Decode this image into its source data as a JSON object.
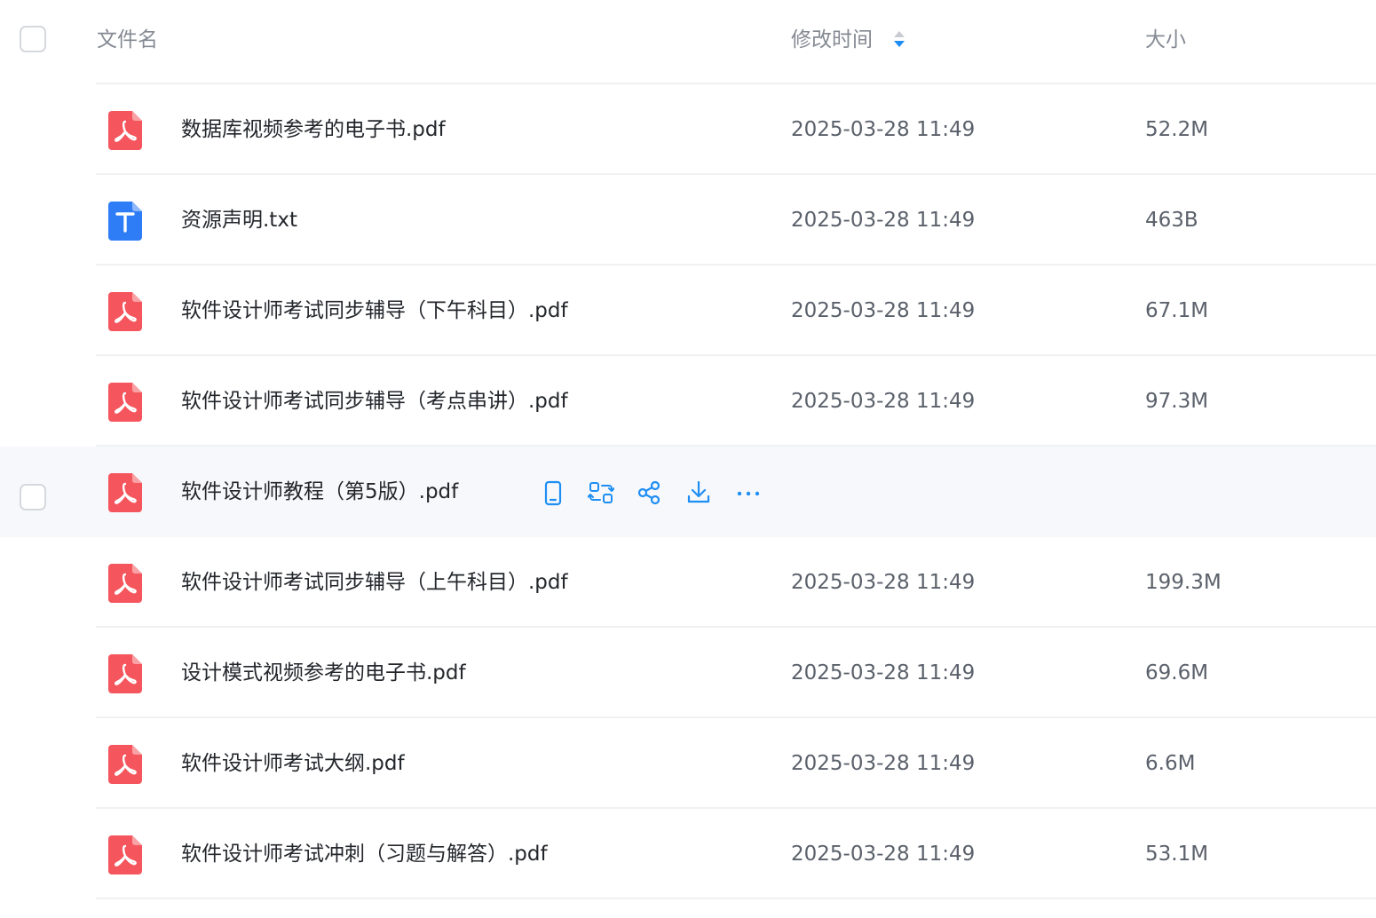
{
  "header": {
    "name_label": "文件名",
    "time_label": "修改时间",
    "size_label": "大小",
    "sort_icon": "sort-updown-icon",
    "sort_active_color": "#1e8ef5"
  },
  "colors": {
    "accent": "#1e8ef5",
    "pdf": "#f5555c",
    "txt": "#2f7df6"
  },
  "files": [
    {
      "name": "数据库视频参考的电子书.pdf",
      "type": "pdf",
      "modified": "2025-03-28 11:49",
      "size": "52.2M"
    },
    {
      "name": "资源声明.txt",
      "type": "txt",
      "modified": "2025-03-28 11:49",
      "size": "463B"
    },
    {
      "name": "软件设计师考试同步辅导（下午科目）.pdf",
      "type": "pdf",
      "modified": "2025-03-28 11:49",
      "size": "67.1M"
    },
    {
      "name": "软件设计师考试同步辅导（考点串讲）.pdf",
      "type": "pdf",
      "modified": "2025-03-28 11:49",
      "size": "97.3M"
    },
    {
      "name": "软件设计师教程（第5版）.pdf",
      "type": "pdf",
      "modified": "",
      "size": "",
      "hovered": true,
      "actions": [
        "phone-icon",
        "convert-icon",
        "share-icon",
        "download-icon",
        "more-icon"
      ]
    },
    {
      "name": "软件设计师考试同步辅导（上午科目）.pdf",
      "type": "pdf",
      "modified": "2025-03-28 11:49",
      "size": "199.3M"
    },
    {
      "name": "设计模式视频参考的电子书.pdf",
      "type": "pdf",
      "modified": "2025-03-28 11:49",
      "size": "69.6M"
    },
    {
      "name": "软件设计师考试大纲.pdf",
      "type": "pdf",
      "modified": "2025-03-28 11:49",
      "size": "6.6M"
    },
    {
      "name": "软件设计师考试冲刺（习题与解答）.pdf",
      "type": "pdf",
      "modified": "2025-03-28 11:49",
      "size": "53.1M"
    }
  ]
}
